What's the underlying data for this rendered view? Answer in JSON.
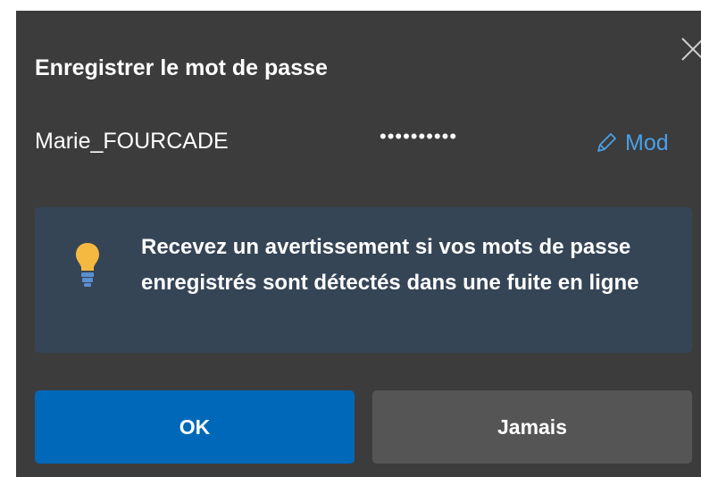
{
  "dialog": {
    "title": "Enregistrer le mot de passe",
    "close_icon": "close-icon"
  },
  "credentials": {
    "username": "Marie_FOURCADE",
    "password_masked": "••••••••••",
    "edit_label": "Mod",
    "edit_icon": "pencil-icon"
  },
  "info": {
    "icon": "lightbulb-icon",
    "text": "Recevez un avertissement si vos mots de passe enregistrés sont détectés dans une fuite en ligne"
  },
  "buttons": {
    "ok_label": "OK",
    "never_label": "Jamais"
  },
  "colors": {
    "background": "#3c3c3c",
    "info_box": "#354556",
    "primary_button": "#0068b8",
    "secondary_button": "#555555",
    "link": "#4aa0e8",
    "bulb": "#f5b942"
  }
}
